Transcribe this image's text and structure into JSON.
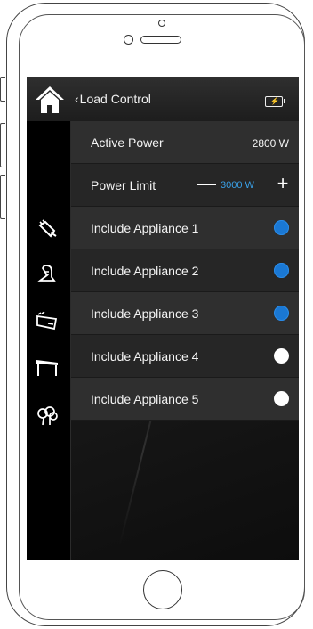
{
  "header": {
    "back_label": "Load Control",
    "icons": {
      "home": "home-icon",
      "back": "chevron-left-icon",
      "battery": "battery-charging-icon"
    }
  },
  "sidebar": {
    "icons": [
      "plug-icon",
      "bell-icon",
      "wallet-icon",
      "table-icon",
      "tree-icon"
    ]
  },
  "active_power": {
    "label": "Active Power",
    "value": "2800 W"
  },
  "power_limit": {
    "label": "Power Limit",
    "minus": "—",
    "value": "3000 W",
    "plus": "+"
  },
  "appliances": [
    {
      "label": "Include Appliance 1",
      "on": true
    },
    {
      "label": "Include Appliance 2",
      "on": true
    },
    {
      "label": "Include Appliance 3",
      "on": true
    },
    {
      "label": "Include Appliance 4",
      "on": false
    },
    {
      "label": "Include Appliance 5",
      "on": false
    }
  ],
  "colors": {
    "accent": "#1a78d4",
    "limit_text": "#3aa0e6",
    "screen_bg": "#101010",
    "off_toggle": "#ffffff"
  }
}
